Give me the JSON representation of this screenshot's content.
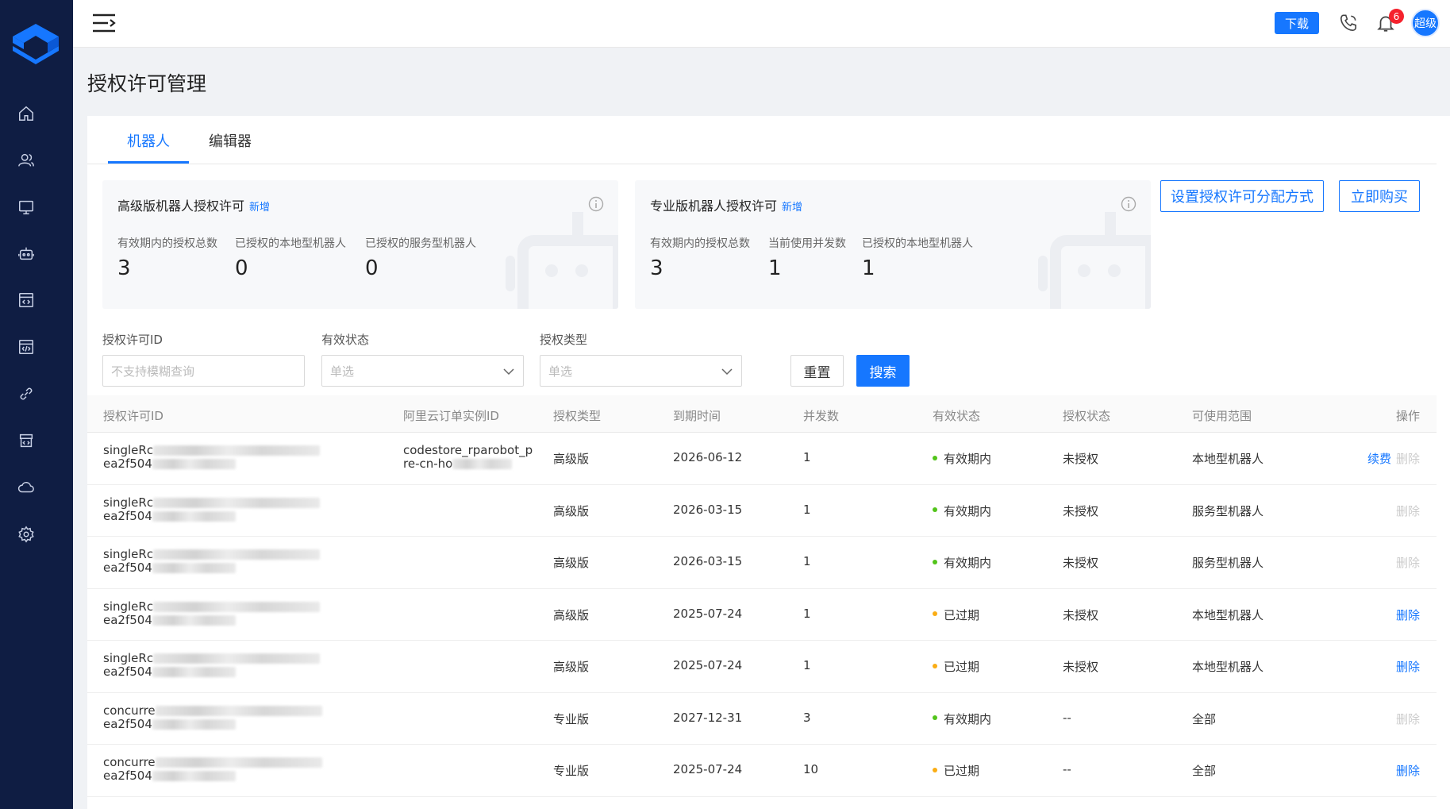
{
  "header": {
    "download_label": "下载",
    "notification_count": "6",
    "avatar_label": "超级"
  },
  "page": {
    "title": "授权许可管理"
  },
  "tabs": [
    {
      "label": "机器人",
      "active": true
    },
    {
      "label": "编辑器",
      "active": false
    }
  ],
  "cards": [
    {
      "title": "高级版机器人授权许可",
      "new_label": "新增",
      "stats": [
        {
          "label": "有效期内的授权总数",
          "value": "3"
        },
        {
          "label": "已授权的本地型机器人",
          "value": "0"
        },
        {
          "label": "已授权的服务型机器人",
          "value": "0"
        }
      ]
    },
    {
      "title": "专业版机器人授权许可",
      "new_label": "新增",
      "stats": [
        {
          "label": "有效期内的授权总数",
          "value": "3"
        },
        {
          "label": "当前使用并发数",
          "value": "1"
        },
        {
          "label": "已授权的本地型机器人",
          "value": "1"
        }
      ]
    }
  ],
  "actions": {
    "set_allocation_label": "设置授权许可分配方式",
    "buy_label": "立即购买"
  },
  "filters": {
    "license_id": {
      "label": "授权许可ID",
      "placeholder": "不支持模糊查询"
    },
    "valid_status": {
      "label": "有效状态",
      "placeholder": "单选"
    },
    "license_type": {
      "label": "授权类型",
      "placeholder": "单选"
    },
    "reset_label": "重置",
    "search_label": "搜索"
  },
  "table": {
    "columns": [
      "授权许可ID",
      "阿里云订单实例ID",
      "授权类型",
      "到期时间",
      "并发数",
      "有效状态",
      "授权状态",
      "可使用范围",
      "操作"
    ],
    "rows": [
      {
        "id_line1": "singleRc",
        "id_line2": "ea2f504",
        "order_line1": "codestore_rparobot_p",
        "order_line2": "re-cn-ho",
        "type": "高级版",
        "expiry": "2026-06-12",
        "concurrency": "1",
        "status": "有效期内",
        "status_color": "#52c41a",
        "auth": "未授权",
        "scope": "本地型机器人",
        "renew": "续费",
        "delete": "删除",
        "delete_enabled": false
      },
      {
        "id_line1": "singleRc",
        "id_line2": "ea2f504",
        "order_line1": "",
        "order_line2": "",
        "type": "高级版",
        "expiry": "2026-03-15",
        "concurrency": "1",
        "status": "有效期内",
        "status_color": "#52c41a",
        "auth": "未授权",
        "scope": "服务型机器人",
        "renew": "",
        "delete": "删除",
        "delete_enabled": false
      },
      {
        "id_line1": "singleRc",
        "id_line2": "ea2f504",
        "order_line1": "",
        "order_line2": "",
        "type": "高级版",
        "expiry": "2026-03-15",
        "concurrency": "1",
        "status": "有效期内",
        "status_color": "#52c41a",
        "auth": "未授权",
        "scope": "服务型机器人",
        "renew": "",
        "delete": "删除",
        "delete_enabled": false
      },
      {
        "id_line1": "singleRc",
        "id_line2": "ea2f504",
        "order_line1": "",
        "order_line2": "",
        "type": "高级版",
        "expiry": "2025-07-24",
        "concurrency": "1",
        "status": "已过期",
        "status_color": "#faad14",
        "auth": "未授权",
        "scope": "本地型机器人",
        "renew": "",
        "delete": "删除",
        "delete_enabled": true
      },
      {
        "id_line1": "singleRc",
        "id_line2": "ea2f504",
        "order_line1": "",
        "order_line2": "",
        "type": "高级版",
        "expiry": "2025-07-24",
        "concurrency": "1",
        "status": "已过期",
        "status_color": "#faad14",
        "auth": "未授权",
        "scope": "本地型机器人",
        "renew": "",
        "delete": "删除",
        "delete_enabled": true
      },
      {
        "id_line1": "concurre",
        "id_line2": "ea2f504",
        "order_line1": "",
        "order_line2": "",
        "type": "专业版",
        "expiry": "2027-12-31",
        "concurrency": "3",
        "status": "有效期内",
        "status_color": "#52c41a",
        "auth": "--",
        "scope": "全部",
        "renew": "",
        "delete": "删除",
        "delete_enabled": false
      },
      {
        "id_line1": "concurre",
        "id_line2": "ea2f504",
        "order_line1": "",
        "order_line2": "",
        "type": "专业版",
        "expiry": "2025-07-24",
        "concurrency": "10",
        "status": "已过期",
        "status_color": "#faad14",
        "auth": "--",
        "scope": "全部",
        "renew": "",
        "delete": "删除",
        "delete_enabled": true
      }
    ]
  },
  "sidebar": {
    "icons": [
      "home-icon",
      "users-icon",
      "monitor-icon",
      "robot-icon",
      "code-window-icon",
      "code-window-icon",
      "link-icon",
      "store-icon",
      "cloud-icon",
      "settings-icon"
    ]
  }
}
